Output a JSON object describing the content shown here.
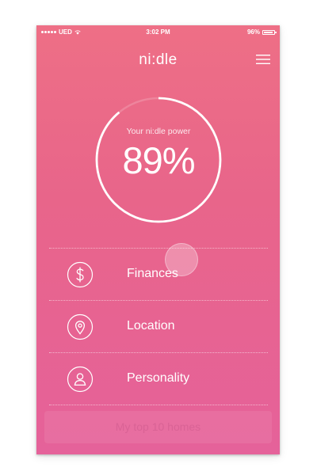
{
  "status_bar": {
    "carrier": "UED",
    "time": "3:02 PM",
    "battery": "96%"
  },
  "header": {
    "brand": "ni:dle",
    "menu_icon": "hamburger-menu-icon"
  },
  "power_gauge": {
    "label": "Your ni:dle power",
    "value_text": "89%",
    "progress": 0.89
  },
  "categories": [
    {
      "label": "Finances",
      "icon": "dollar-icon"
    },
    {
      "label": "Location",
      "icon": "location-pin-icon"
    },
    {
      "label": "Personality",
      "icon": "person-icon"
    }
  ],
  "cta": {
    "label": "My top 10 homes"
  },
  "colors": {
    "gradient_top": "#ee6f86",
    "gradient_bottom": "#e5629a",
    "foreground": "#ffffff"
  }
}
